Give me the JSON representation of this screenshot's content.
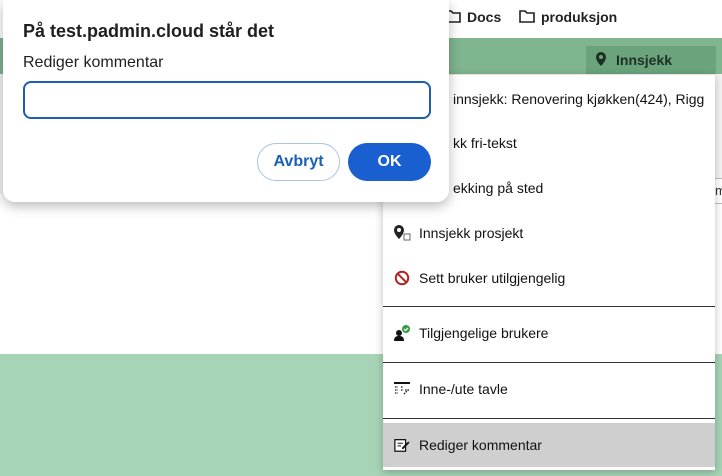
{
  "bookmarks": {
    "items": [
      {
        "label": "Docs",
        "icon": "folder-icon"
      },
      {
        "label": "produksjon",
        "icon": "folder-icon"
      }
    ]
  },
  "header": {
    "innsjekk_label": "Innsjekk",
    "innsjekk_icon": "map-pin-icon"
  },
  "menu": {
    "items": [
      {
        "label": "innsjekk: Renovering kjøkken(424), Rigg",
        "icon": "",
        "active": false
      },
      {
        "label": "kk fri-tekst",
        "icon": "",
        "active": false
      },
      {
        "label": "ekking på sted",
        "icon": "",
        "active": false
      },
      {
        "label": "Innsjekk prosjekt",
        "icon": "pin-project-icon",
        "active": false
      },
      {
        "label": "Sett bruker utilgjengelig",
        "icon": "prohibited-icon",
        "active": false
      },
      {
        "label": "Tilgjengelige brukere",
        "icon": "user-check-icon",
        "active": false
      },
      {
        "label": "Inne-/ute tavle",
        "icon": "board-icon",
        "active": false
      },
      {
        "label": "Rediger kommentar",
        "icon": "edit-note-icon",
        "active": true
      }
    ]
  },
  "dialog": {
    "title": "På test.padmin.cloud står det",
    "message": "Rediger kommentar",
    "input_value": "",
    "cancel_label": "Avbryt",
    "ok_label": "OK"
  },
  "colors": {
    "header_green": "#7fb58f",
    "bottom_green": "#a7d4b6",
    "ok_blue": "#1a5fd0"
  }
}
